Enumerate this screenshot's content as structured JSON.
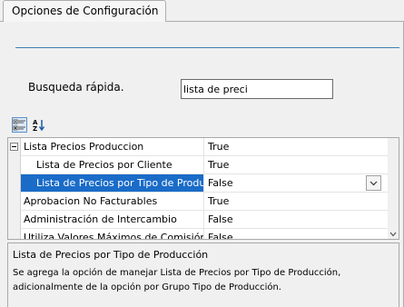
{
  "tab": {
    "title": "Opciones de Configuración"
  },
  "search": {
    "label": "Busqueda rápida.",
    "value": "lista de preci"
  },
  "toolbar": {
    "categorized_icon": "categorized-icon",
    "alphabetical_icon": "alphabetical-sort-icon"
  },
  "grid": {
    "rows": [
      {
        "name": "Lista Precios Produccion",
        "value": "True",
        "kind": "category",
        "expander": "collapse-icon"
      },
      {
        "name": "Lista de Precios por Cliente",
        "value": "True",
        "kind": "child"
      },
      {
        "name": "Lista de Precios por Tipo de Produccion",
        "value": "False",
        "kind": "child",
        "selected": true,
        "dropdown_icon": "chevron-down-icon"
      },
      {
        "name": "Aprobacion No Facturables",
        "value": "True",
        "kind": "plain"
      },
      {
        "name": "Administración de Intercambio",
        "value": "False",
        "kind": "plain"
      },
      {
        "name": "Utiliza Valores Máximos de Comisión",
        "value": "False",
        "kind": "plain"
      }
    ]
  },
  "description": {
    "title": "Lista de Precios por Tipo de Producción",
    "text": "Se agrega la opción de manejar Lista de Precios por Tipo de Producción, adicionalmente de la opción por Grupo Tipo de Producción."
  },
  "colors": {
    "selection": "#1a6cc8",
    "rule": "#3c7fb1",
    "background": "#f0f0f0"
  }
}
